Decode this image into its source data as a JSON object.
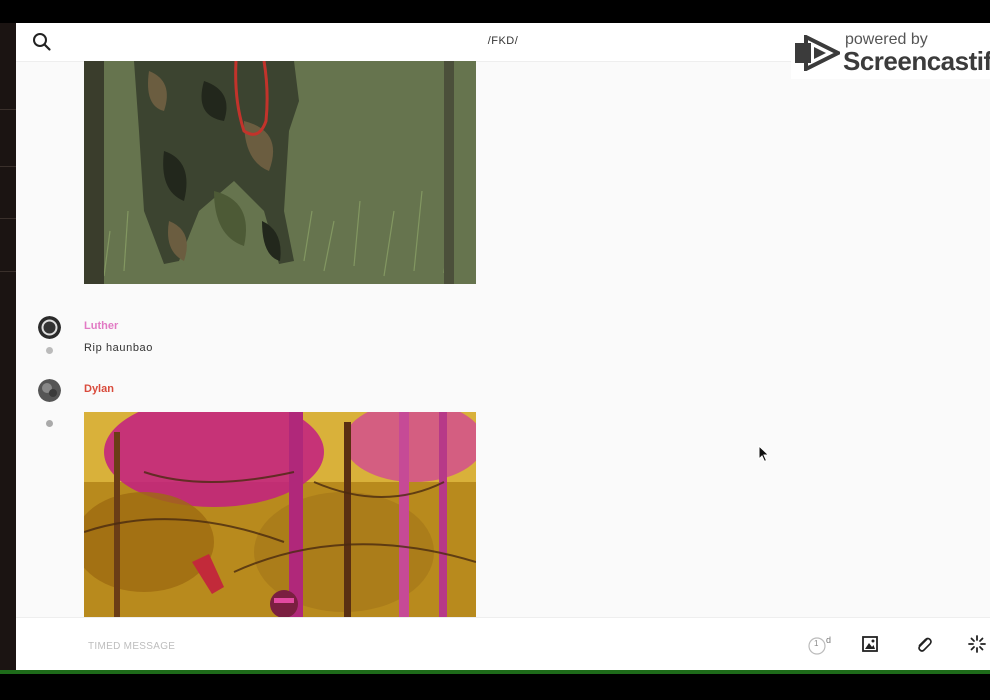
{
  "header": {
    "channel_title": "/FKD/"
  },
  "watermark": {
    "powered_by": "powered by",
    "brand": "Screencastify"
  },
  "messages": [
    {
      "author": "Luther",
      "text": "Rip haunbao",
      "author_color": "#e27ac4"
    },
    {
      "author": "Dylan",
      "text": "",
      "author_color": "#d94b3c"
    }
  ],
  "composer": {
    "placeholder": "TIMED MESSAGE",
    "timer_value": "1",
    "timer_unit": "d"
  },
  "icons": {
    "search": "search-icon",
    "phone": "phone-icon",
    "info": "info-icon",
    "image": "image-icon",
    "attach": "paperclip-icon",
    "more": "sparkle-icon"
  },
  "colors": {
    "bottom_accent": "#1e6b1a",
    "background": "#fafafa"
  }
}
